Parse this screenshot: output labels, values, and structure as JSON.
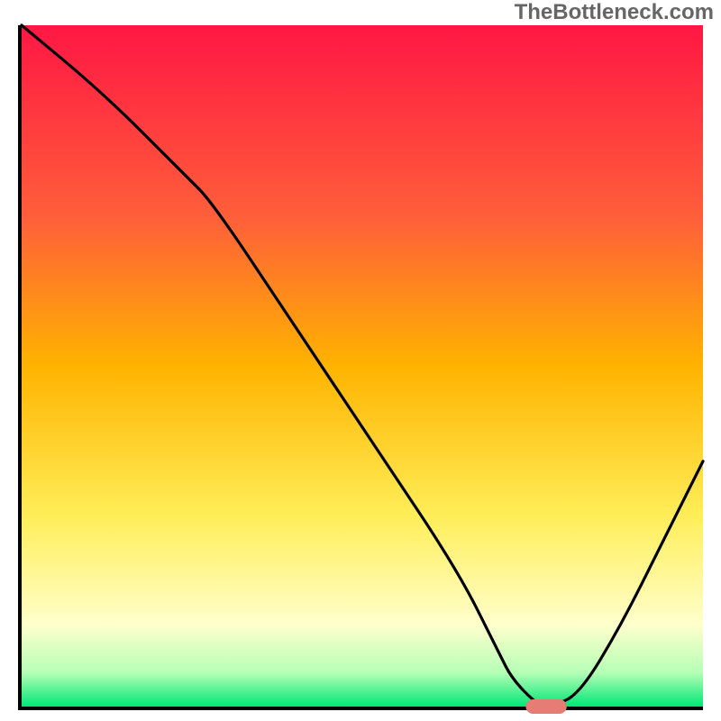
{
  "watermark": "TheBottleneck.com",
  "chart_data": {
    "type": "line",
    "title": "",
    "xlabel": "",
    "ylabel": "",
    "xlim": [
      0,
      100
    ],
    "ylim": [
      0,
      100
    ],
    "series": [
      {
        "name": "curve",
        "x": [
          0,
          12,
          24,
          28,
          40,
          52,
          64,
          70,
          72,
          76,
          78,
          82,
          88,
          94,
          100
        ],
        "values": [
          100,
          90,
          78,
          74,
          56,
          38,
          20,
          8,
          4,
          0,
          0,
          2,
          12,
          24,
          36
        ]
      }
    ],
    "marker": {
      "x_start": 74,
      "x_end": 80,
      "y": 0
    },
    "gradient_colors": {
      "top": "#ff1744",
      "upper_mid": "#ff5e3a",
      "mid": "#ffb300",
      "lower_mid": "#ffee58",
      "pale": "#ffffcc",
      "base_top": "#b6ffb6",
      "base": "#00e676"
    }
  }
}
